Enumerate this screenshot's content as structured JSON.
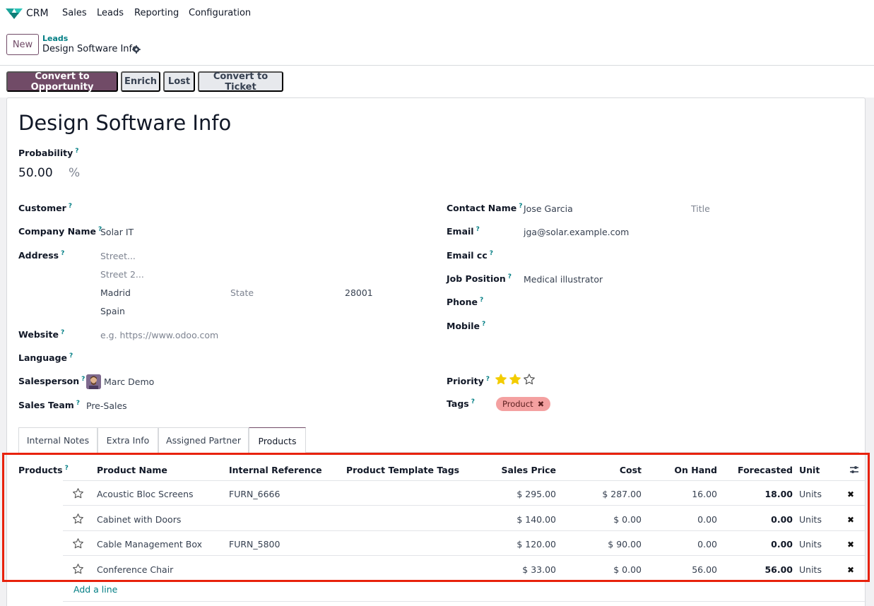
{
  "navbar": {
    "app_name": "CRM",
    "menu": [
      "Sales",
      "Leads",
      "Reporting",
      "Configuration"
    ]
  },
  "controlbar": {
    "new_label": "New",
    "breadcrumb_parent": "Leads",
    "breadcrumb_current": "Design Software Info"
  },
  "actions": {
    "convert_opportunity": "Convert to Opportunity",
    "enrich": "Enrich",
    "lost": "Lost",
    "convert_ticket": "Convert to Ticket"
  },
  "form": {
    "title": "Design Software Info",
    "probability_label": "Probability",
    "probability_value": "50.00",
    "probability_unit": "%",
    "customer_label": "Customer",
    "company_name_label": "Company Name",
    "company_name_value": "Solar IT",
    "address_label": "Address",
    "street_placeholder": "Street...",
    "street2_placeholder": "Street 2...",
    "city": "Madrid",
    "state_placeholder": "State",
    "zip": "28001",
    "country": "Spain",
    "website_label": "Website",
    "website_placeholder": "e.g. https://www.odoo.com",
    "language_label": "Language",
    "salesperson_label": "Salesperson",
    "salesperson_value": "Marc Demo",
    "sales_team_label": "Sales Team",
    "sales_team_value": "Pre-Sales",
    "contact_name_label": "Contact Name",
    "contact_name_value": "Jose Garcia",
    "title_placeholder": "Title",
    "email_label": "Email",
    "email_value": "jga@solar.example.com",
    "email_cc_label": "Email cc",
    "job_position_label": "Job Position",
    "job_position_value": "Medical illustrator",
    "phone_label": "Phone",
    "mobile_label": "Mobile",
    "priority_label": "Priority",
    "priority_value": 2,
    "priority_max": 3,
    "tags_label": "Tags",
    "tags": [
      "Product"
    ],
    "help_marker": "?"
  },
  "tabs": [
    "Internal Notes",
    "Extra Info",
    "Assigned Partner",
    "Products"
  ],
  "products": {
    "field_label": "Products",
    "columns": {
      "name": "Product Name",
      "ref": "Internal Reference",
      "tags": "Product Template Tags",
      "price": "Sales Price",
      "cost": "Cost",
      "on_hand": "On Hand",
      "forecasted": "Forecasted",
      "unit": "Unit"
    },
    "rows": [
      {
        "name": "Acoustic Bloc Screens",
        "ref": "FURN_6666",
        "price": "$ 295.00",
        "cost": "$ 287.00",
        "on_hand": "16.00",
        "forecasted": "18.00",
        "unit": "Units"
      },
      {
        "name": "Cabinet with Doors",
        "ref": "",
        "price": "$ 140.00",
        "cost": "$ 0.00",
        "on_hand": "0.00",
        "forecasted": "0.00",
        "unit": "Units"
      },
      {
        "name": "Cable Management Box",
        "ref": "FURN_5800",
        "price": "$ 120.00",
        "cost": "$ 90.00",
        "on_hand": "0.00",
        "forecasted": "0.00",
        "unit": "Units"
      },
      {
        "name": "Conference Chair",
        "ref": "",
        "price": "$ 33.00",
        "cost": "$ 0.00",
        "on_hand": "56.00",
        "forecasted": "56.00",
        "unit": "Units"
      }
    ],
    "add_line": "Add a line",
    "delete_glyph": "✖"
  },
  "colors": {
    "brand": "#714b67",
    "link": "#017e84",
    "tag_bg": "#f4a0a0",
    "star": "#f3cc00",
    "highlight": "#e8220c"
  }
}
